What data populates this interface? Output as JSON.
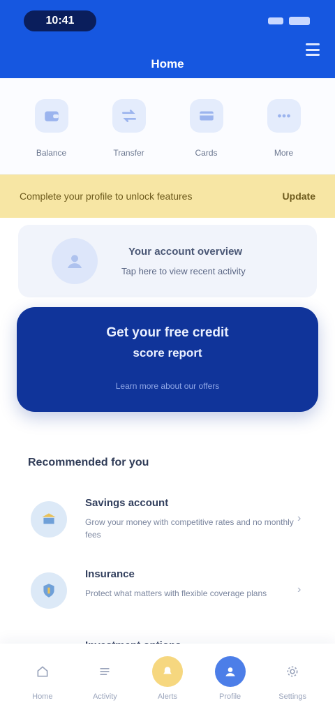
{
  "status_bar": {
    "time": "10:41"
  },
  "header": {
    "title": "Home"
  },
  "quick_actions": [
    {
      "icon": "wallet-icon",
      "label": "Balance"
    },
    {
      "icon": "transfer-icon",
      "label": "Transfer"
    },
    {
      "icon": "card-icon",
      "label": "Cards"
    },
    {
      "icon": "more-icon",
      "label": "More"
    }
  ],
  "banner": {
    "text": "Complete your profile to unlock features",
    "link": "Update"
  },
  "info_card": {
    "title": "Your account overview",
    "subtitle": "Tap here to view recent activity"
  },
  "promo_card": {
    "title": "Get your free credit",
    "subtitle": "score report",
    "footer": "Learn more about our offers"
  },
  "section": {
    "title": "Recommended for you"
  },
  "list_items": [
    {
      "icon": "bank-icon",
      "title": "Savings account",
      "desc": "Grow your money with competitive rates and no monthly fees"
    },
    {
      "icon": "shield-icon",
      "title": "Insurance",
      "desc": "Protect what matters with flexible coverage plans"
    },
    {
      "icon": "chart-icon",
      "title": "Investment options",
      "desc": ""
    }
  ],
  "bottom_nav": [
    {
      "icon": "home-icon",
      "label": "Home"
    },
    {
      "icon": "list-icon",
      "label": "Activity"
    },
    {
      "icon": "alert-icon",
      "label": "Alerts",
      "style": "warn"
    },
    {
      "icon": "user-icon",
      "label": "Profile",
      "style": "active"
    },
    {
      "icon": "settings-icon",
      "label": "Settings"
    }
  ],
  "colors": {
    "primary": "#1657e0",
    "promo": "#10349a",
    "banner": "#f7e6a4"
  }
}
